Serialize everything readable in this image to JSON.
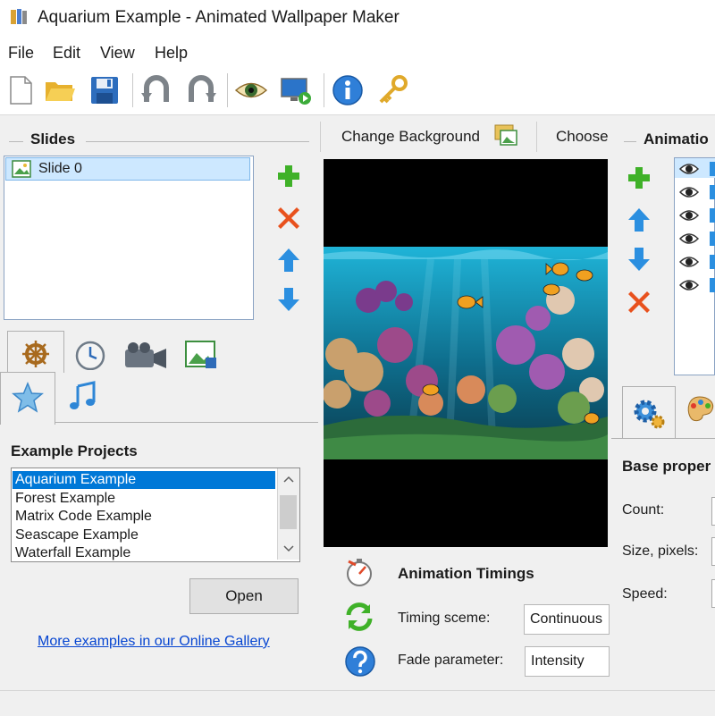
{
  "window": {
    "title": "Aquarium Example - Animated Wallpaper Maker"
  },
  "menu": [
    "File",
    "Edit",
    "View",
    "Help"
  ],
  "toolbar": {
    "buttons": [
      "new-file-icon",
      "open-folder-icon",
      "save-icon",
      "undo-icon",
      "redo-icon",
      "preview-eye-icon",
      "apply-wallpaper-icon",
      "info-icon",
      "key-icon"
    ]
  },
  "slides_panel": {
    "title": "Slides",
    "items": [
      "Slide 0"
    ]
  },
  "center_top": {
    "change_background": "Change Background",
    "choose": "Choose"
  },
  "animations_panel": {
    "title": "Animatio"
  },
  "examples": {
    "title": "Example Projects",
    "items": [
      "Aquarium Example",
      "Forest Example",
      "Matrix Code Example",
      "Seascape Example",
      "Waterfall Example"
    ],
    "selected": 0,
    "open_label": "Open",
    "gallery_link": "More examples in our Online Gallery"
  },
  "timings": {
    "title": "Animation Timings",
    "scheme_label": "Timing sceme:",
    "scheme_value": "Continuous",
    "fade_label": "Fade parameter:",
    "fade_value": "Intensity"
  },
  "base_properties": {
    "title": "Base proper",
    "count_label": "Count:",
    "size_label": "Size, pixels:",
    "speed_label": "Speed:"
  },
  "colors": {
    "selection": "#cde8ff",
    "link": "#0645d1",
    "add": "#3fb128",
    "delete": "#e8511d",
    "arrow": "#2b8fe0"
  }
}
